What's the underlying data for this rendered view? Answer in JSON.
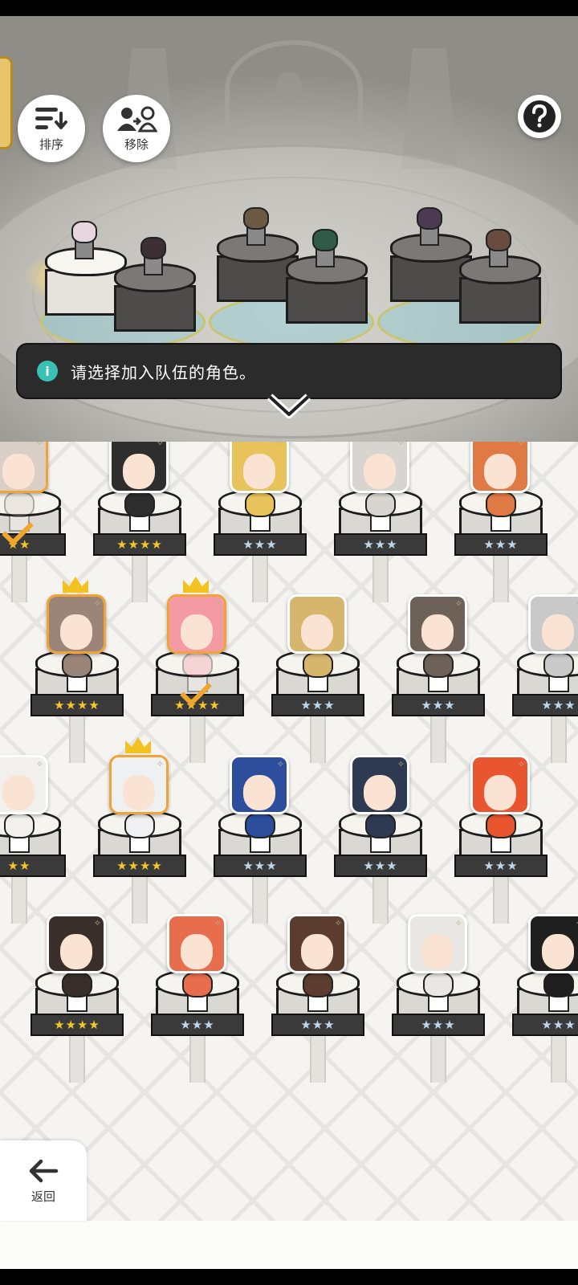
{
  "toolbar": {
    "sort_label": "排序",
    "remove_label": "移除"
  },
  "hint": {
    "text": "请选择加入队伍的角色。"
  },
  "back": {
    "label": "返回"
  },
  "team_slots": [
    {
      "status": "leader"
    },
    {
      "status": "member"
    },
    {
      "status": "member"
    },
    {
      "status": "member"
    },
    {
      "status": "member"
    },
    {
      "status": "member"
    }
  ],
  "roster": [
    {
      "stars": "★★",
      "rarity": "gold",
      "crown": true,
      "selected": true,
      "hair": "#d9cfc6"
    },
    {
      "stars": "★★★★",
      "rarity": "gold",
      "crown": false,
      "selected": false,
      "hair": "#2e2e2e"
    },
    {
      "stars": "★★★",
      "rarity": "silver",
      "crown": false,
      "selected": false,
      "hair": "#e8c25a"
    },
    {
      "stars": "★★★",
      "rarity": "silver",
      "crown": false,
      "selected": false,
      "hair": "#d8d4d0"
    },
    {
      "stars": "★★★",
      "rarity": "silver",
      "crown": false,
      "selected": false,
      "hair": "#e07a45"
    },
    {
      "stars": "★★★★",
      "rarity": "gold",
      "crown": true,
      "selected": false,
      "hair": "#9b8579"
    },
    {
      "stars": "★★★★",
      "rarity": "gold",
      "crown": true,
      "selected": true,
      "hair": "#f39aa5"
    },
    {
      "stars": "★★★",
      "rarity": "silver",
      "crown": false,
      "selected": false,
      "hair": "#d6b56d"
    },
    {
      "stars": "★★★",
      "rarity": "silver",
      "crown": false,
      "selected": false,
      "hair": "#6e6158"
    },
    {
      "stars": "★★★",
      "rarity": "silver",
      "crown": false,
      "selected": false,
      "hair": "#c9c9c9"
    },
    {
      "stars": "★★",
      "rarity": "gold",
      "crown": false,
      "selected": false,
      "hair": "#f2f0ec"
    },
    {
      "stars": "★★★★",
      "rarity": "gold",
      "crown": true,
      "selected": false,
      "hair": "#eef0f2"
    },
    {
      "stars": "★★★",
      "rarity": "silver",
      "crown": false,
      "selected": false,
      "hair": "#2d4e9c"
    },
    {
      "stars": "★★★",
      "rarity": "silver",
      "crown": false,
      "selected": false,
      "hair": "#2e3a52"
    },
    {
      "stars": "★★★",
      "rarity": "silver",
      "crown": false,
      "selected": false,
      "hair": "#e9552f"
    },
    {
      "stars": "★★★★",
      "rarity": "gold",
      "crown": false,
      "selected": false,
      "hair": "#3a2e2a"
    },
    {
      "stars": "★★★",
      "rarity": "silver",
      "crown": false,
      "selected": false,
      "hair": "#e76d4c"
    },
    {
      "stars": "★★★",
      "rarity": "silver",
      "crown": false,
      "selected": false,
      "hair": "#5b3c2e"
    },
    {
      "stars": "★★★",
      "rarity": "silver",
      "crown": false,
      "selected": false,
      "hair": "#e9e7e3"
    },
    {
      "stars": "★★★",
      "rarity": "silver",
      "crown": false,
      "selected": false,
      "hair": "#1f1f1f"
    }
  ],
  "colors": {
    "accent": "#3bc1b4",
    "gold_star": "#f3c62a",
    "silver_star": "#bcd7ec",
    "owned_frame": "#f0a336"
  }
}
